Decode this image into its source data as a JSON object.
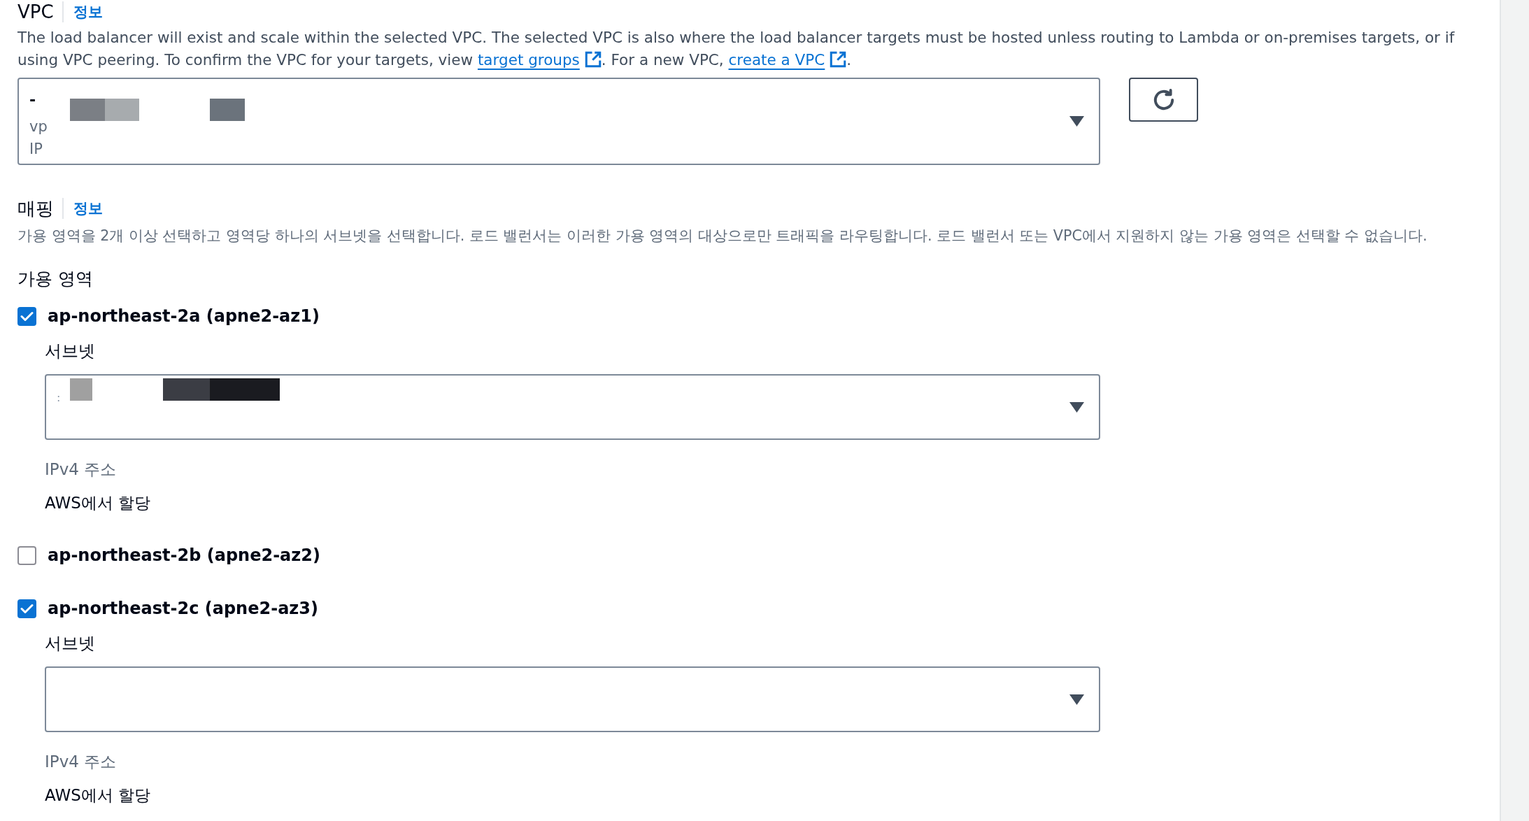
{
  "vpc": {
    "title": "VPC",
    "info_link": "정보",
    "description": [
      {
        "kind": "text",
        "text": "The load balancer will exist and scale within the selected VPC. The selected VPC is also where the load balancer targets must be hosted unless routing to Lambda or on-premises targets, or if using VPC peering. To confirm the VPC for your targets, view "
      },
      {
        "kind": "link",
        "text": "target groups"
      },
      {
        "kind": "text",
        "text": ". For a new VPC, "
      },
      {
        "kind": "link",
        "text": "create a VPC"
      },
      {
        "kind": "text",
        "text": "."
      }
    ],
    "select": {
      "lines": [
        "-",
        "vp",
        "IP"
      ],
      "redactions": [
        {
          "segments": [
            {
              "color": "#7b7f85"
            },
            {
              "color": "#a7abae"
            }
          ]
        },
        {
          "segments": [
            {
              "color": "#6b737c"
            }
          ]
        }
      ]
    }
  },
  "mapping": {
    "title": "매핑",
    "info_link": "정보",
    "description": "가용 영역을 2개 이상 선택하고 영역당 하나의 서브넷을 선택합니다. 로드 밸런서는 이러한 가용 영역의 대상으로만 트래픽을 라우팅합니다. 로드 밸런서 또는 VPC에서 지원하지 않는 가용 영역은 선택할 수 없습니다.",
    "zones_label": "가용 영역",
    "zones": [
      {
        "label": "ap-northeast-2a (apne2-az1)",
        "checked": true,
        "subnet": {
          "label": "서브넷",
          "lines": [
            ":"
          ],
          "redactions": [
            {
              "segments": [
                {
                  "color": "#a0a0a0"
                }
              ]
            },
            {
              "segments": [
                {
                  "color": "#3b3d44"
                },
                {
                  "color": "#1a1b20"
                }
              ]
            }
          ]
        },
        "ipv4": {
          "label": "IPv4 주소",
          "value": "AWS에서 할당"
        }
      },
      {
        "label": "ap-northeast-2b (apne2-az2)",
        "checked": false
      },
      {
        "label": "ap-northeast-2c (apne2-az3)",
        "checked": true,
        "subnet": {
          "label": "서브넷"
        },
        "ipv4": {
          "label": "IPv4 주소",
          "value": "AWS에서 할당"
        }
      }
    ]
  }
}
